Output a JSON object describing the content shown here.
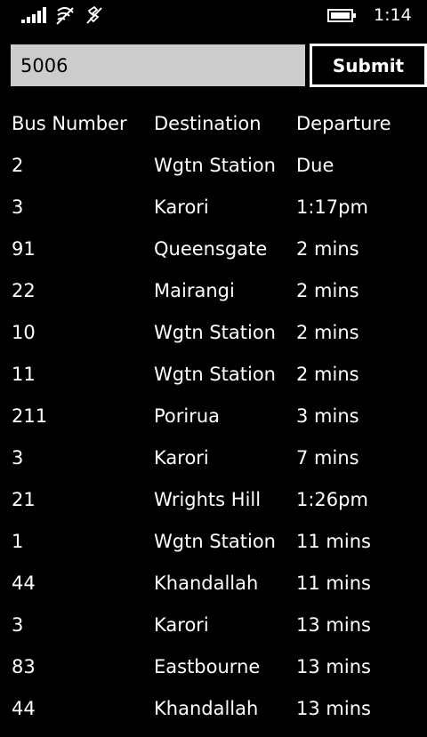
{
  "status_bar": {
    "time": "1:14",
    "icons": [
      "signal-strength-icon",
      "wifi-icon",
      "data-connection-icon",
      "battery-icon"
    ]
  },
  "search": {
    "value": "5006",
    "placeholder": ""
  },
  "submit_label": "Submit",
  "colors": {
    "background": "#000000",
    "text": "#ffffff",
    "input_background": "#cccccc"
  },
  "table": {
    "headers": [
      "Bus Number",
      "Destination",
      "Departure"
    ],
    "rows": [
      [
        "2",
        "Wgtn Station",
        "Due"
      ],
      [
        "3",
        "Karori",
        "1:17pm"
      ],
      [
        "91",
        "Queensgate",
        "2 mins"
      ],
      [
        "22",
        "Mairangi",
        "2 mins"
      ],
      [
        "10",
        "Wgtn Station",
        "2 mins"
      ],
      [
        "11",
        "Wgtn Station",
        "2 mins"
      ],
      [
        "211",
        "Porirua",
        "3 mins"
      ],
      [
        "3",
        "Karori",
        "7 mins"
      ],
      [
        "21",
        "Wrights Hill",
        "1:26pm"
      ],
      [
        "1",
        "Wgtn Station",
        "11 mins"
      ],
      [
        "44",
        "Khandallah",
        "11 mins"
      ],
      [
        "3",
        "Karori",
        "13 mins"
      ],
      [
        "83",
        "Eastbourne",
        "13 mins"
      ],
      [
        "44",
        "Khandallah",
        "13 mins"
      ]
    ]
  }
}
